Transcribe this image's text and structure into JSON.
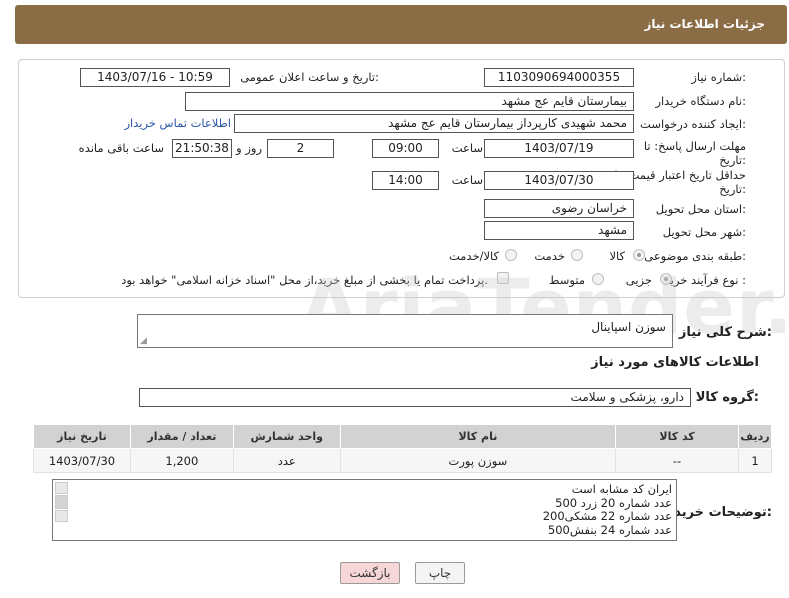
{
  "header": {
    "title": "جزئیات اطلاعات نیاز"
  },
  "form": {
    "need_number_label": "شماره نیاز:",
    "need_number": "1103090694000355",
    "announce_label": "تاریخ و ساعت اعلان عمومی:",
    "announce_value": "1403/07/16 - 10:59",
    "buyer_org_label": "نام دستگاه خریدار:",
    "buyer_org": "بیمارستان قایم  عج  مشهد",
    "creator_label": "ایجاد کننده درخواست:",
    "creator": "محمد شهیدی کارپرداز بیمارستان قایم  عج  مشهد",
    "contact_link": "اطلاعات تماس خریدار",
    "deadline_label_1": "مهلت ارسال پاسخ: تا",
    "deadline_label_2": "تاریخ:",
    "deadline_date": "1403/07/19",
    "time_label": "ساعت",
    "deadline_time": "09:00",
    "days_value": "2",
    "days_label": "روز و",
    "remaining_time": "21:50:38",
    "remaining_label": "ساعت باقی مانده",
    "validity_label_1": "حداقل تاریخ اعتبار قیمت: تا",
    "validity_label_2": "تاریخ:",
    "validity_date": "1403/07/30",
    "validity_time": "14:00",
    "province_label": "استان محل تحویل:",
    "province": "خراسان رضوی",
    "city_label": "شهر محل تحویل:",
    "city": "مشهد",
    "category_label": "طبقه بندی موضوعی:",
    "category_options": [
      "کالا",
      "خدمت",
      "کالا/خدمت"
    ],
    "process_label": "نوع فرآیند خرید :",
    "process_options": [
      "جزیی",
      "متوسط"
    ],
    "payment_note": "پرداخت تمام یا بخشی از مبلغ خرید،از محل \"اسناد خزانه اسلامی\" خواهد بود."
  },
  "watermark": "AriaTender.net",
  "summary": {
    "label": "شرح کلی نیاز:",
    "value": "سوزن اسپاینال"
  },
  "goods_info_title": "اطلاعات کالاهای مورد نیاز",
  "goods_group": {
    "label": "گروه کالا:",
    "value": "دارو، پزشکی و سلامت"
  },
  "table": {
    "headers": [
      "ردیف",
      "کد کالا",
      "نام کالا",
      "واحد شمارش",
      "تعداد / مقدار",
      "تاریخ نیاز"
    ],
    "rows": [
      [
        "1",
        "--",
        "سوزن پورت",
        "عدد",
        "1,200",
        "1403/07/30"
      ]
    ]
  },
  "buyer_notes": {
    "label": "توضیحات خریدار:",
    "lines": [
      "ایران کد مشابه است",
      "500 عدد شماره 20 زرد",
      "200عدد شماره 22 مشکی",
      "500عدد شماره 24 بنفش"
    ]
  },
  "buttons": {
    "print": "چاپ",
    "back": "بازگشت"
  },
  "colors": {
    "header": "#8b6d45",
    "link": "#2a56a8",
    "back_button": "#f6d6d6"
  }
}
